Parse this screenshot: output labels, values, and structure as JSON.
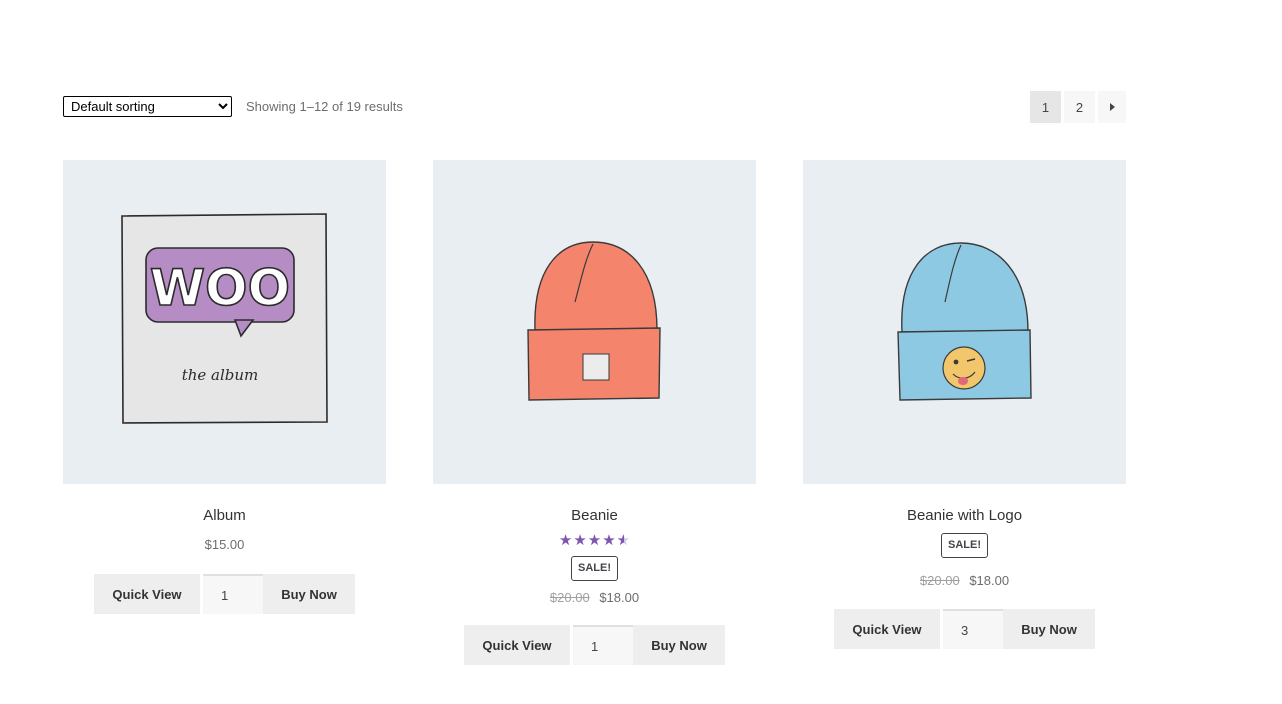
{
  "toolbar": {
    "sort_selected": "Default sorting",
    "result_count": "Showing 1–12 of 19 results"
  },
  "pagination": {
    "pages": [
      "1",
      "2"
    ],
    "current": "1"
  },
  "products": [
    {
      "title": "Album",
      "price": "$15.00",
      "quick_view": "Quick View",
      "quantity": "1",
      "buy_now": "Buy Now"
    },
    {
      "title": "Beanie",
      "rating": 4.5,
      "sale_badge": "SALE!",
      "old_price": "$20.00",
      "price": "$18.00",
      "quick_view": "Quick View",
      "quantity": "1",
      "buy_now": "Buy Now"
    },
    {
      "title": "Beanie with Logo",
      "sale_badge": "SALE!",
      "old_price": "$20.00",
      "price": "$18.00",
      "quick_view": "Quick View",
      "quantity": "3",
      "buy_now": "Buy Now"
    }
  ],
  "album_art": {
    "logo_text": "WOO",
    "caption": "the album"
  },
  "colors": {
    "star": "#7f54b3",
    "image_bg": "#e9eef2",
    "button_bg": "#eeeeee",
    "orange_beanie": "#f4846c",
    "blue_beanie": "#8ec9e3",
    "woo_purple": "#b58cc4"
  }
}
